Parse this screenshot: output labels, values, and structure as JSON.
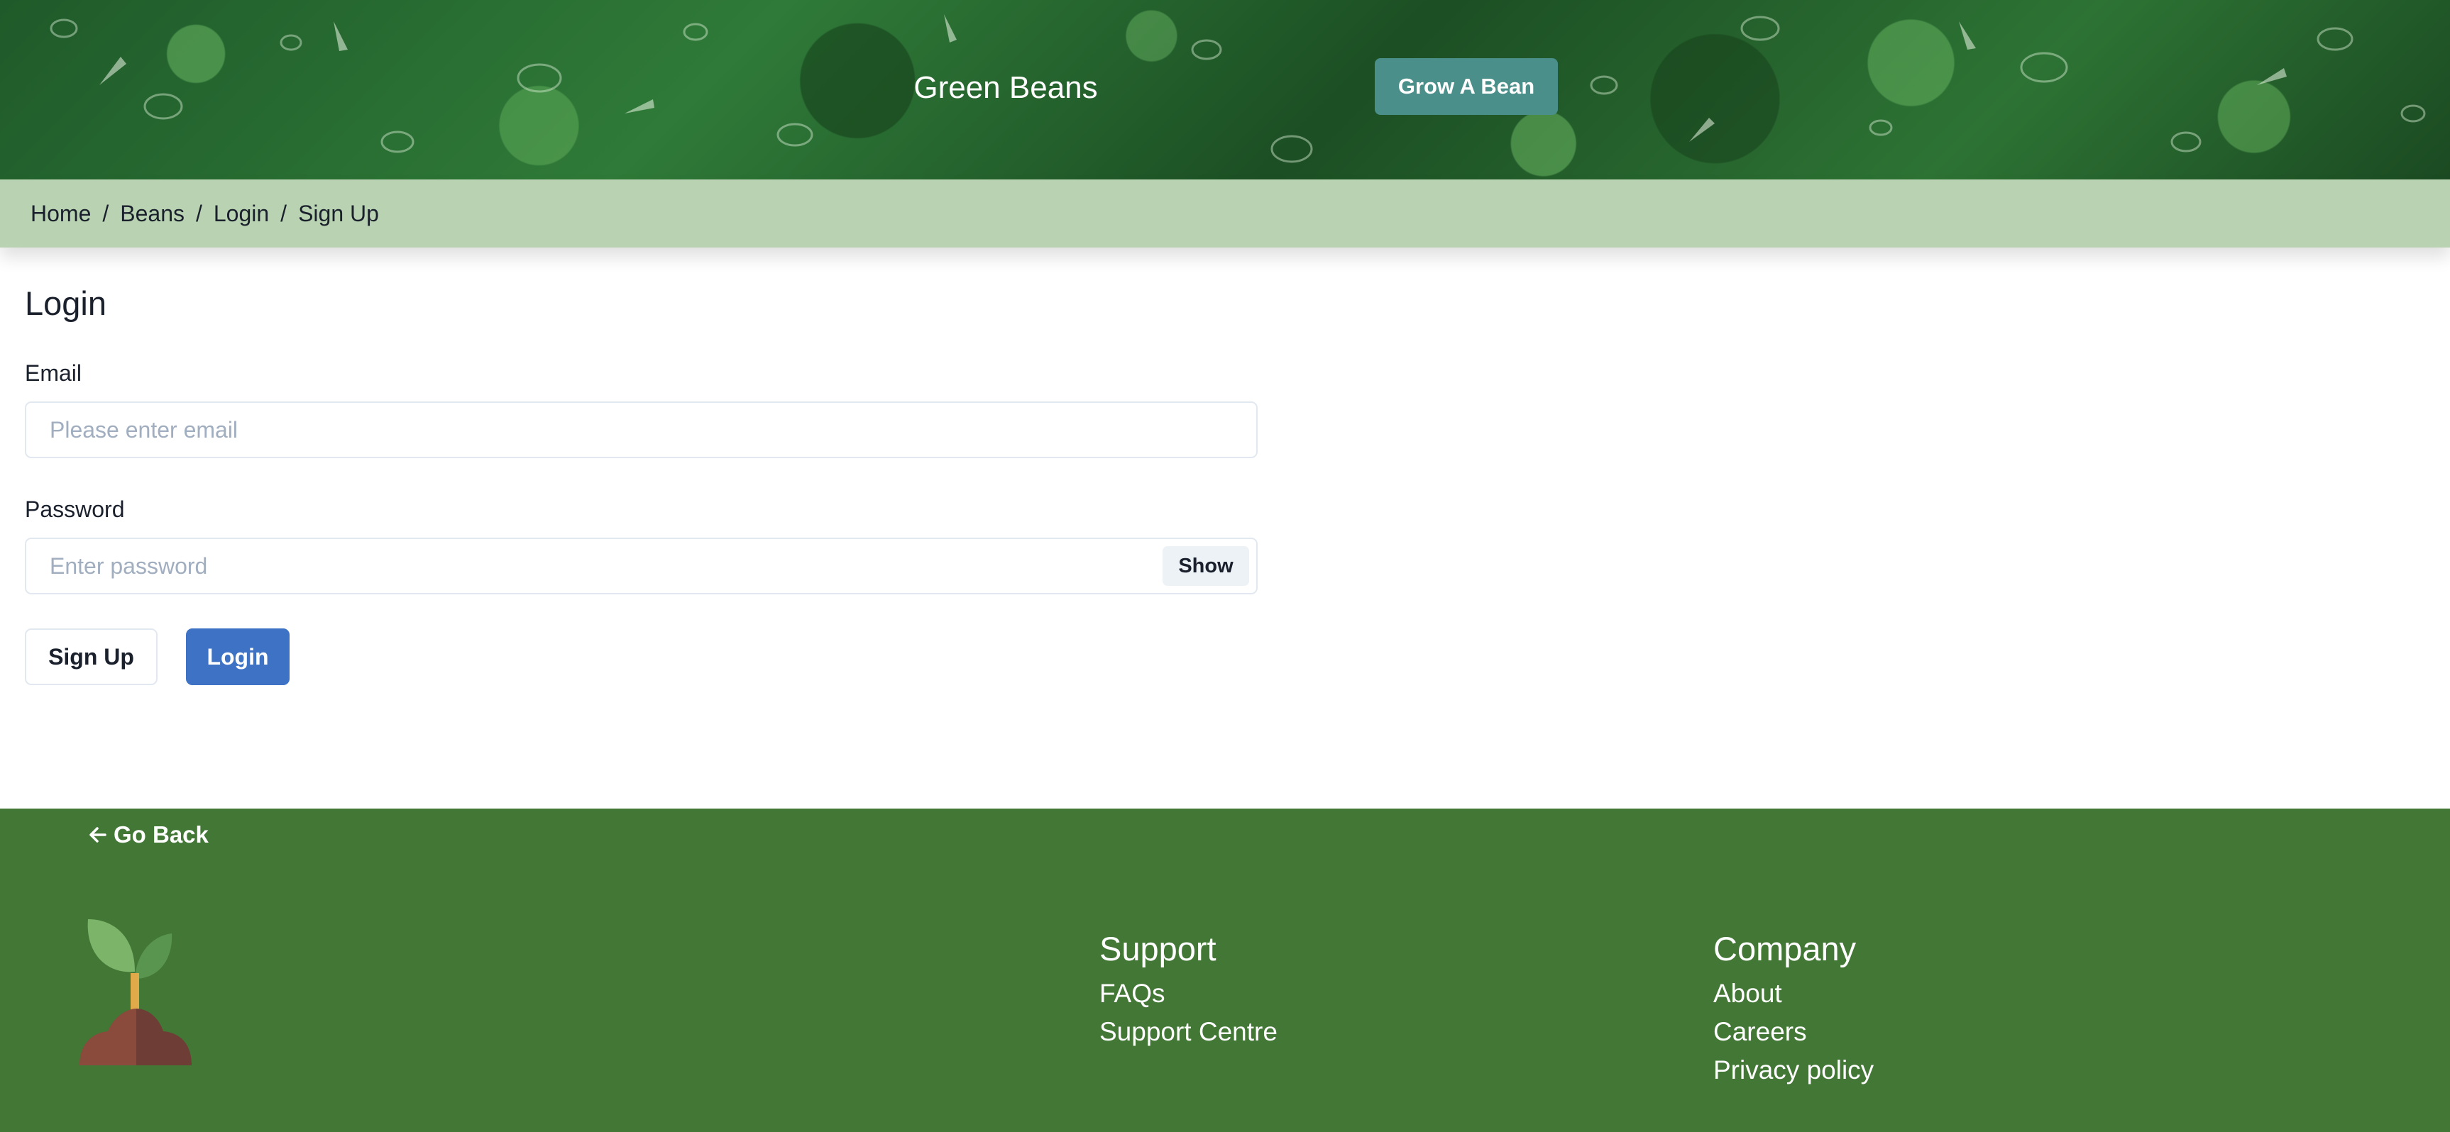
{
  "header": {
    "title": "Green Beans",
    "cta_label": "Grow A Bean"
  },
  "breadcrumb": {
    "items": [
      "Home",
      "Beans",
      "Login",
      "Sign Up"
    ],
    "separator": "/"
  },
  "login_form": {
    "title": "Login",
    "email": {
      "label": "Email",
      "placeholder": "Please enter email",
      "value": ""
    },
    "password": {
      "label": "Password",
      "placeholder": "Enter password",
      "value": "",
      "toggle_label": "Show"
    },
    "signup_label": "Sign Up",
    "login_label": "Login"
  },
  "footer": {
    "go_back_label": "Go Back",
    "go_back_icon": "arrow-left-icon",
    "logo_icon": "sprout-icon",
    "support": {
      "title": "Support",
      "links": [
        "FAQs",
        "Support Centre"
      ]
    },
    "company": {
      "title": "Company",
      "links": [
        "About",
        "Careers",
        "Privacy policy"
      ]
    }
  },
  "colors": {
    "breadcrumb_bg": "#b9d3b2",
    "primary_button": "#3d72c4",
    "header_button": "#4a8f8a",
    "footer_bg": "#437735"
  }
}
